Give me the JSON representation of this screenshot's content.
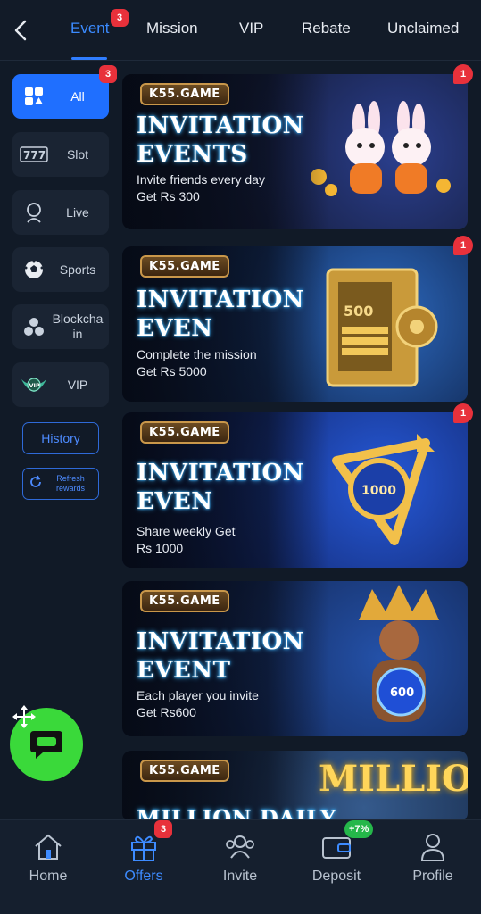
{
  "topbar": {
    "tabs": [
      {
        "label": "Event",
        "badge": "3",
        "active": true
      },
      {
        "label": "Mission"
      },
      {
        "label": "VIP"
      },
      {
        "label": "Rebate"
      },
      {
        "label": "Unclaimed"
      }
    ]
  },
  "sidebar": {
    "items": [
      {
        "label": "All",
        "icon": "grid-icon",
        "badge": "3",
        "active": true
      },
      {
        "label": "Slot",
        "icon": "slot-777-icon"
      },
      {
        "label": "Live",
        "icon": "dealer-icon"
      },
      {
        "label": "Sports",
        "icon": "soccer-ball-icon"
      },
      {
        "label": "Blockchain",
        "icon": "blockchain-icon"
      },
      {
        "label": "VIP",
        "icon": "vip-crest-icon"
      }
    ],
    "history_label": "History",
    "refresh_label": "Refresh rewards"
  },
  "banners": [
    {
      "logo": "K55.GAME",
      "title_line1": "INVITATION",
      "title_line2": "EVENTS",
      "line1": "Invite friends every day",
      "line2": "Get Rs 300",
      "badge": "1"
    },
    {
      "logo": "K55.GAME",
      "title_line1": "INVITATION",
      "title_line2": "EVEN",
      "line1": "Complete the mission",
      "line2": "Get Rs 5000",
      "badge": "1"
    },
    {
      "logo": "K55.GAME",
      "title_line1": "INVITATION",
      "title_line2": "EVEN",
      "line1": "Share weekly Get",
      "line2": "Rs 1000",
      "badge": "1"
    },
    {
      "logo": "K55.GAME",
      "title_line1": "INVITATION",
      "title_line2": "EVENT",
      "line1": "Each player you invite",
      "line2": "Get Rs600"
    },
    {
      "logo": "K55.GAME",
      "title_line1": "MILLION DAILY",
      "art_text": "MILLION"
    }
  ],
  "banner_art": {
    "safe_label": "500",
    "coin_label": "1000",
    "orb_label": "600"
  },
  "bottom_nav": [
    {
      "label": "Home",
      "icon": "home-icon"
    },
    {
      "label": "Offers",
      "icon": "gift-icon",
      "badge": "3",
      "active": true
    },
    {
      "label": "Invite",
      "icon": "people-icon"
    },
    {
      "label": "Deposit",
      "icon": "wallet-icon",
      "badge": "+7%"
    },
    {
      "label": "Profile",
      "icon": "person-icon"
    }
  ],
  "colors": {
    "accent": "#1f6fff",
    "badge": "#e8313b",
    "chat": "#3ad93a",
    "background": "#111a27"
  }
}
